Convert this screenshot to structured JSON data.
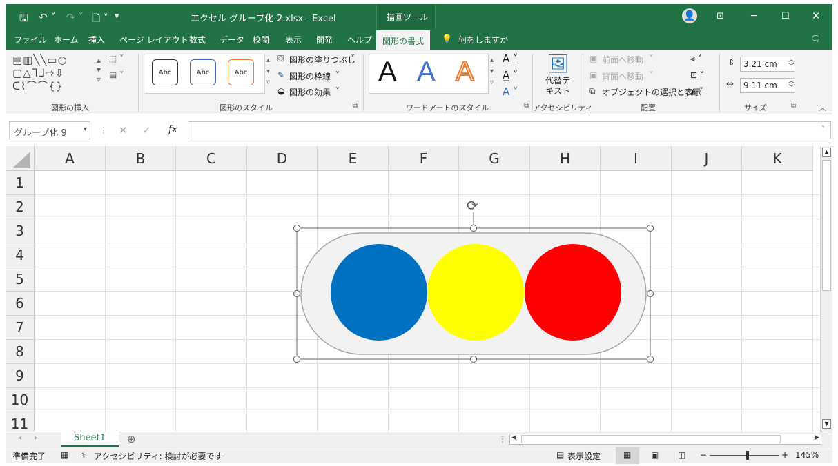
{
  "titlebar": {
    "save_icon": "save-icon",
    "undo_icon": "undo-icon",
    "redo_icon": "redo-icon",
    "title": "エクセル グループ化-2.xlsx  -  Excel",
    "tool_context": "描画ツール"
  },
  "menu": {
    "file": "ファイル",
    "home": "ホーム",
    "insert": "挿入",
    "page_layout": "ページ レイアウト",
    "formulas": "数式",
    "data": "データ",
    "review": "校閲",
    "view": "表示",
    "developer": "開発",
    "help": "ヘルプ",
    "shape_format": "図形の書式",
    "tell_me": "何をしますか"
  },
  "ribbon": {
    "group_insert_shapes": "図形の挿入",
    "group_shape_styles": "図形のスタイル",
    "style_sample": "Abc",
    "shape_fill": "図形の塗りつぶし",
    "shape_outline": "図形の枠線",
    "shape_effects": "図形の効果",
    "group_wordart": "ワードアートのスタイル",
    "wordart_sample": "A",
    "alt_text": "代替テ\nキスト",
    "group_accessibility": "アクセシビリティ",
    "bring_forward": "前面へ移動",
    "send_backward": "背面へ移動",
    "selection_pane": "オブジェクトの選択と表示",
    "group_arrange": "配置",
    "height": "3.21 cm",
    "width": "9.11 cm",
    "group_size": "サイズ"
  },
  "formula_bar": {
    "name_box": "グループ化 9",
    "fx": "fx",
    "value": ""
  },
  "grid": {
    "columns": [
      "A",
      "B",
      "C",
      "D",
      "E",
      "F",
      "G",
      "H",
      "I",
      "J",
      "K"
    ],
    "rows": [
      "1",
      "2",
      "3",
      "4",
      "5",
      "6",
      "7",
      "8",
      "9",
      "10",
      "11"
    ]
  },
  "shape": {
    "fill": "#f2f2f2",
    "outline": "#a6a6a6",
    "circles": [
      "#0070c0",
      "#ffff00",
      "#ff0000"
    ]
  },
  "sheets": {
    "active": "Sheet1",
    "add_icon": "plus-circle-icon"
  },
  "status": {
    "ready": "準備完了",
    "accessibility": "アクセシビリティ: 検討が必要です",
    "display_settings": "表示設定",
    "zoom": "145%"
  }
}
